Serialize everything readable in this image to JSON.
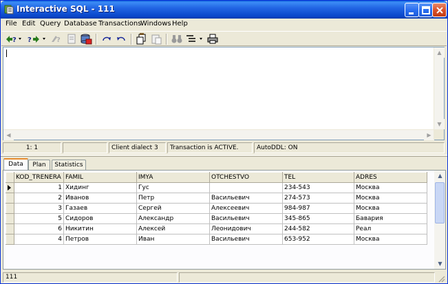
{
  "window": {
    "title": "Interactive SQL - 111",
    "title_color": "#0a5bd7"
  },
  "menu": [
    "File",
    "Edit",
    "Query",
    "Database",
    "Transactions",
    "Windows",
    "Help"
  ],
  "editor": {
    "text": ""
  },
  "editor_status": {
    "position": "1:  1",
    "blank": "",
    "dialect": "Client dialect 3",
    "transaction": "Transaction is ACTIVE.",
    "autoddl": "AutoDDL: ON"
  },
  "tabs": [
    {
      "label": "Data",
      "active": true
    },
    {
      "label": "Plan",
      "active": false
    },
    {
      "label": "Statistics",
      "active": false
    }
  ],
  "grid": {
    "columns": [
      "KOD_TRENERA",
      "FAMIL",
      "IMYA",
      "OTCHESTVO",
      "TEL",
      "ADRES"
    ],
    "rows": [
      [
        "1",
        "Хидинг",
        "Гус",
        "",
        "234-543",
        "Москва"
      ],
      [
        "2",
        "Иванов",
        "Петр",
        "Васильевич",
        "274-573",
        "Москва"
      ],
      [
        "3",
        "Газаев",
        "Сергей",
        "Алексеевич",
        "984-987",
        "Москва"
      ],
      [
        "5",
        "Сидоров",
        "Александр",
        "Васильевич",
        "345-865",
        "Бавария"
      ],
      [
        "6",
        "Никитин",
        "Алексей",
        "Леонидович",
        "244-582",
        "Реал"
      ],
      [
        "4",
        "Петров",
        "Иван",
        "Васильевич",
        "653-952",
        "Москва"
      ]
    ]
  },
  "statusbar": {
    "db": "111",
    "right": ""
  }
}
